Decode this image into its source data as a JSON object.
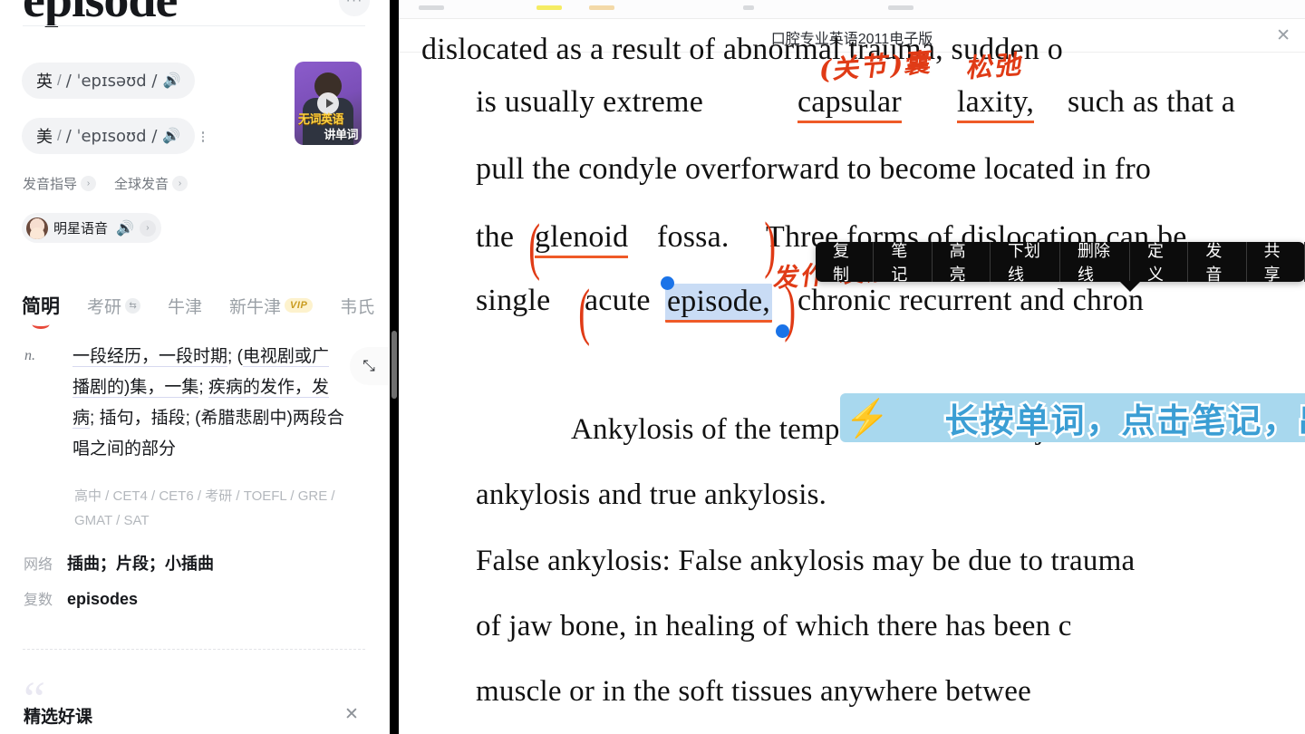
{
  "dictionary": {
    "headword": "episode",
    "more_icon": "ellipsis-icon",
    "pronunciations": [
      {
        "lang": "英",
        "ipa": "/ ˈepɪsəʊd /",
        "speaker_icon": "speaker-icon"
      },
      {
        "lang": "美",
        "ipa": "/ ˈepɪsoʊd /",
        "speaker_icon": "speaker-icon"
      }
    ],
    "video_card": {
      "line1": "无词英语",
      "line2": "讲单词",
      "play_icon": "play-icon"
    },
    "guide_links": [
      {
        "label": "发音指导",
        "chevron": "chevron-right-icon"
      },
      {
        "label": "全球发音",
        "chevron": "chevron-right-icon"
      }
    ],
    "star_voice": {
      "label": "明星语音",
      "speaker_icon": "speaker-icon",
      "chevron": "chevron-right-icon"
    },
    "tabs": [
      {
        "label": "简明",
        "active": true
      },
      {
        "label": "考研",
        "active": false,
        "icon": "swap-icon"
      },
      {
        "label": "牛津",
        "active": false
      },
      {
        "label": "新牛津",
        "active": false,
        "badge": "VIP"
      },
      {
        "label": "韦氏",
        "active": false
      }
    ],
    "definition": {
      "pos": "n.",
      "segments": [
        {
          "text": "一段经历，一段时期",
          "underline": true
        },
        {
          "text": "; (",
          "underline": false
        },
        {
          "text": "电视剧或广播剧的)集，一集",
          "underline": true
        },
        {
          "text": "; ",
          "underline": false
        },
        {
          "text": "疾病的发作，发病",
          "underline": true
        },
        {
          "text": "; 插句，插段; (希腊悲剧中)两段合唱之间的部分",
          "underline": false
        }
      ],
      "expand_icon": "expand-arrows-icon"
    },
    "exam_tags": "高中 / CET4 / CET6 / 考研 / TOEFL / GRE / GMAT / SAT",
    "network": {
      "key": "网络",
      "value": "插曲；片段；小插曲"
    },
    "plural": {
      "key": "复数",
      "value": "episodes"
    },
    "course_section": {
      "title": "精选好课",
      "close_icon": "close-icon"
    }
  },
  "reader": {
    "title": "口腔专业英语2011电子版",
    "close_icon": "close-icon",
    "context_menu": {
      "items": [
        "复制",
        "笔记",
        "高亮",
        "下划线",
        "删除线",
        "定义",
        "发音",
        "共享"
      ]
    },
    "banner": {
      "text": "长按单词，点击笔记，出现文本框",
      "color": "#a8d8ee"
    },
    "selection": {
      "word": "episode",
      "highlight_color": "#c9dcf5",
      "handle_color": "#1a73e8"
    },
    "annotations": [
      {
        "text": "(关节)囊",
        "over": "capsular"
      },
      {
        "text": "松弛",
        "over": "laxity"
      },
      {
        "text": "发作 发病",
        "over": "episode"
      }
    ],
    "lines": [
      {
        "id": "l0",
        "text": "dislocated as a result of abnormal trauma, sudden    o"
      },
      {
        "id": "l1a",
        "text": "is   usually extreme "
      },
      {
        "id": "l1b",
        "text": "capsular"
      },
      {
        "id": "l1c",
        "text": "laxity,"
      },
      {
        "id": "l1d",
        "text": "such as   that a"
      },
      {
        "id": "l2",
        "text": "pull the condyle overforward to become located in fro"
      },
      {
        "id": "l3a",
        "text": "the"
      },
      {
        "id": "l3b",
        "text": "glenoid"
      },
      {
        "id": "l3c",
        "text": "fossa."
      },
      {
        "id": "l3d",
        "text": "Three  forms  of  dislocation  can  be"
      },
      {
        "id": "l4a",
        "text": "single"
      },
      {
        "id": "l4b",
        "text": "acute"
      },
      {
        "id": "l4c",
        "text": "episode,"
      },
      {
        "id": "l4d",
        "text": "chronic   recurrent   and   chron"
      },
      {
        "id": "l5",
        "text": "Ankylosis of the temporo-mandibular joir"
      },
      {
        "id": "l6",
        "text": "ankylosis and true ankylosis."
      },
      {
        "id": "l7",
        "text": "False ankylosis: False ankylosis may be due to trauma"
      },
      {
        "id": "l8",
        "text": "of jaw bone, in healing of which   there has been c"
      },
      {
        "id": "l9",
        "text": "muscle   or   in   the   soft tissues anywhere betwee"
      }
    ]
  }
}
